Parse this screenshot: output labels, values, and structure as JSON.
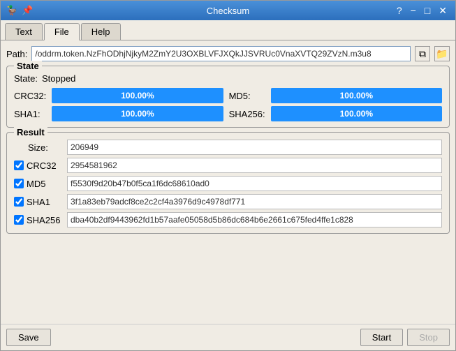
{
  "window": {
    "title": "Checksum",
    "icon": "🦆"
  },
  "titlebar": {
    "help_label": "?",
    "minimize_label": "−",
    "maximize_label": "□",
    "close_label": "✕"
  },
  "tabs": [
    {
      "id": "text",
      "label": "Text",
      "active": false
    },
    {
      "id": "file",
      "label": "File",
      "active": true
    },
    {
      "id": "help",
      "label": "Help",
      "active": false
    }
  ],
  "path": {
    "label": "Path:",
    "value": "/oddrm.token.NzFhODhjNjkyM2ZmY2U3OXBLVFJXQkJJSVRUc0VnaXVTQ29ZVzN.m3u8",
    "copy_tooltip": "Copy",
    "browse_tooltip": "Browse"
  },
  "state": {
    "group_title": "State",
    "state_label": "State:",
    "state_value": "Stopped",
    "crc32_label": "CRC32:",
    "crc32_progress": "100.00%",
    "md5_label": "MD5:",
    "md5_progress": "100.00%",
    "sha1_label": "SHA1:",
    "sha1_progress": "100.00%",
    "sha256_label": "SHA256:",
    "sha256_progress": "100.00%"
  },
  "result": {
    "group_title": "Result",
    "size_label": "Size:",
    "size_value": "206949",
    "crc32_label": "CRC32",
    "crc32_value": "2954581962",
    "md5_label": "MD5",
    "md5_value": "f5530f9d20b47b0f5ca1f6dc68610ad0",
    "sha1_label": "SHA1",
    "sha1_value": "3f1a83eb79adcf8ce2c2cf4a3976d9c4978df771",
    "sha256_label": "SHA256",
    "sha256_value": "dba40b2df9443962fd1b57aafe05058d5b86dc684b6e2661c675fed4ffe1c828"
  },
  "buttons": {
    "save_label": "Save",
    "start_label": "Start",
    "stop_label": "Stop"
  }
}
